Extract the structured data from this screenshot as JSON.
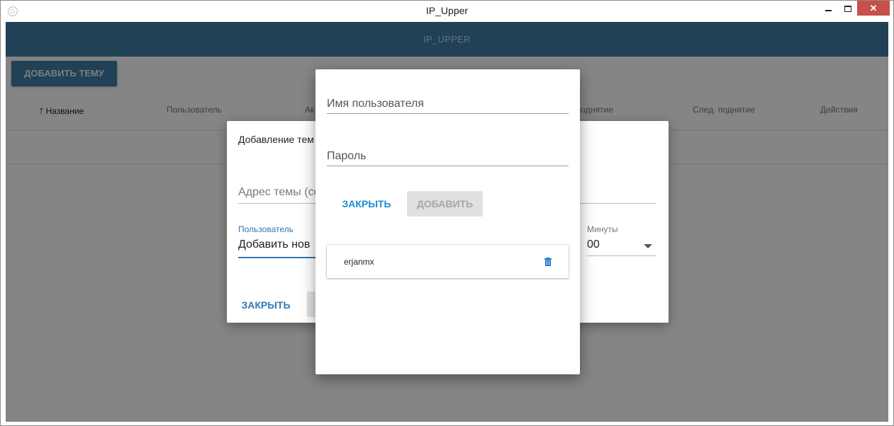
{
  "window": {
    "title": "IP_Upper"
  },
  "app": {
    "title": "IP_UPPER",
    "add_topic_label": "ДОБАВИТЬ ТЕМУ",
    "columns": [
      "Название",
      "Пользователь",
      "Ак",
      "поднятие",
      "След. поднятие",
      "Действия"
    ]
  },
  "topic_dialog": {
    "title": "Добавление тем",
    "url_placeholder": "Адрес темы (сс",
    "user_label": "Пользователь",
    "user_value": "Добавить нов",
    "minutes_label": "Минуты",
    "minutes_value": "00",
    "close_label": "ЗАКРЫТЬ"
  },
  "user_dialog": {
    "username_placeholder": "Имя пользователя",
    "password_placeholder": "Пароль",
    "close_label": "ЗАКРЫТЬ",
    "add_label": "ДОБАВИТЬ",
    "users": [
      {
        "name": "erjanmx"
      }
    ]
  },
  "colors": {
    "primary": "#3f7ea6",
    "accent": "#1a8fd6",
    "close_button": "#c7504a"
  }
}
